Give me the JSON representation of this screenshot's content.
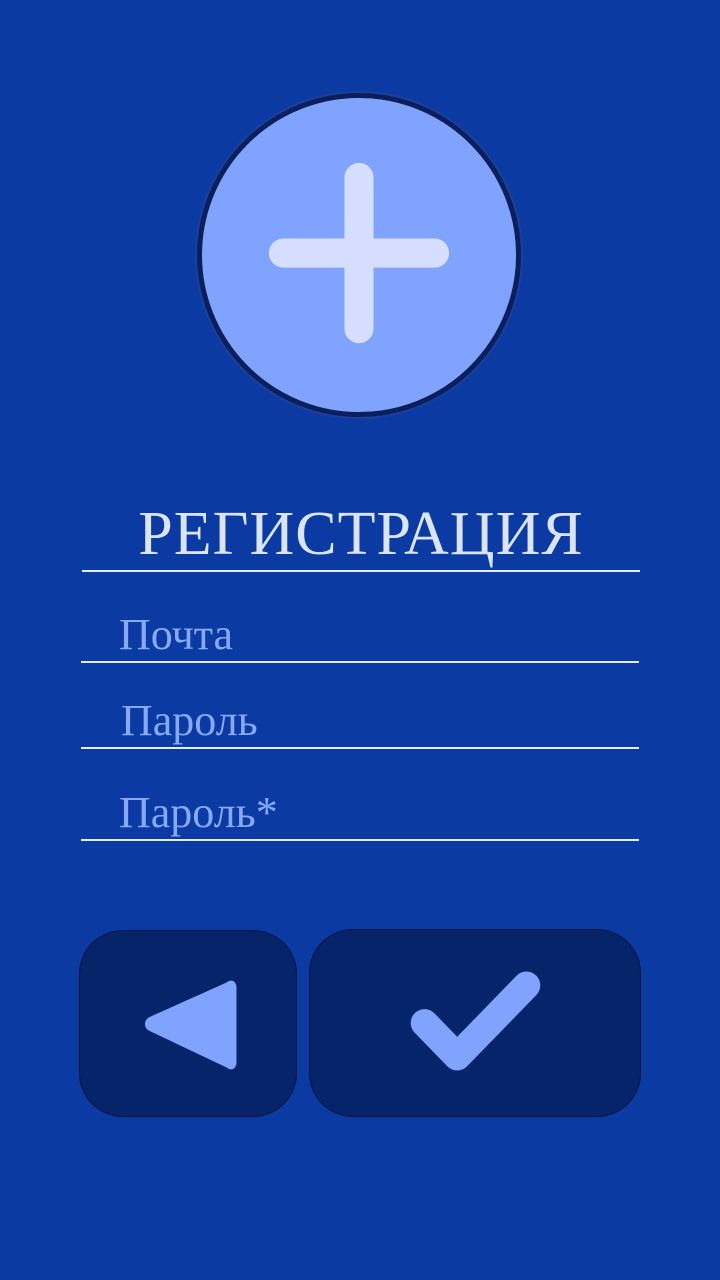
{
  "colors": {
    "background": "#0b3ba2",
    "avatar_fill": "#7fa3ff",
    "plus_icon": "#d6deff",
    "title_text": "#dbe4ff",
    "field_label": "#86a8ff",
    "underline": "#e6ecff",
    "button_fill": "#05246a",
    "button_icon": "#7fa3ff"
  },
  "avatar": {
    "icon": "plus-icon"
  },
  "title": "РЕГИСТРАЦИЯ",
  "form": {
    "email_label": "Почта",
    "password_label": "Пароль",
    "password_confirm_label": "Пароль*"
  },
  "buttons": {
    "back_icon": "triangle-left-icon",
    "confirm_icon": "checkmark-icon"
  }
}
